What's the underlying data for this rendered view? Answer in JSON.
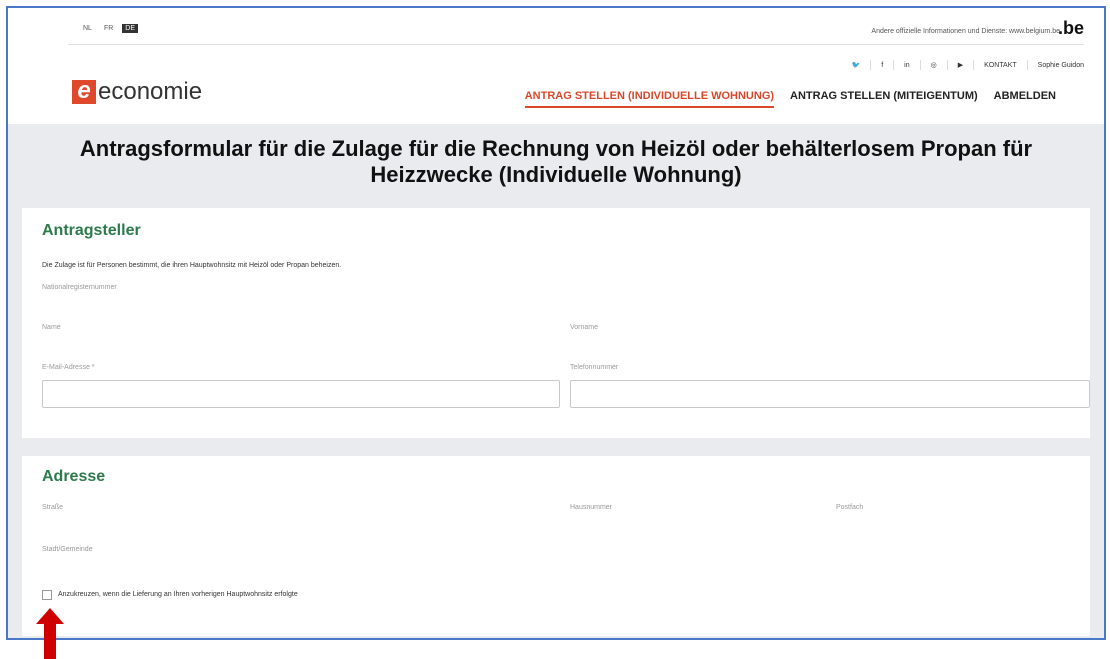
{
  "lang": {
    "items": [
      "NL",
      "FR",
      "DE"
    ],
    "active": "DE"
  },
  "toplinks": {
    "text": "Andere offizielle Informationen und Dienste: www.belgium.be",
    "be": ".be"
  },
  "social": {
    "kontakt": "KONTAKT",
    "user": "Sophie Guidon"
  },
  "logo": {
    "mark": "e",
    "text": "economie"
  },
  "nav": {
    "item1": "ANTRAG STELLEN (INDIVIDUELLE WOHNUNG)",
    "item2": "ANTRAG STELLEN (MITEIGENTUM)",
    "item3": "ABMELDEN"
  },
  "page": {
    "title": "Antragsformular für die Zulage für die Rechnung von Heizöl oder behälterlosem Propan für Heizzwecke (Individuelle Wohnung)"
  },
  "section1": {
    "title": "Antragsteller",
    "info": "Die Zulage ist für Personen bestimmt, die ihren Hauptwohnsitz mit Heizöl oder Propan beheizen.",
    "national_label": "Nationalregisternummer",
    "name_label": "Name",
    "vorname_label": "Vorname",
    "email_label": "E-Mail-Adresse *",
    "telefon_label": "Telefonnummer",
    "email_value": "",
    "telefon_value": ""
  },
  "section2": {
    "title": "Adresse",
    "strasse": "Straße",
    "hausnummer": "Hausnummer",
    "postfach": "Postfach",
    "stadt": "Stadt/Gemeinde",
    "checkbox_label": "Anzukreuzen, wenn die Lieferung an Ihren vorherigen Hauptwohnsitz erfolgte"
  },
  "colors": {
    "accent": "#d9482c",
    "section": "#2d7b4b",
    "frame": "#4a78c8",
    "arrow": "#d10000"
  }
}
